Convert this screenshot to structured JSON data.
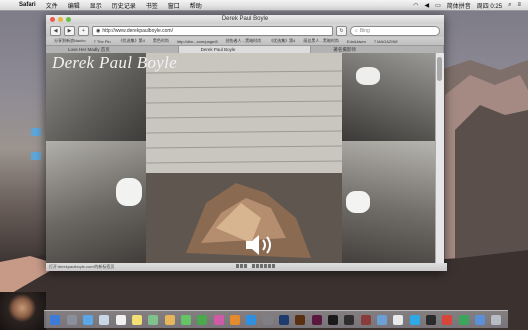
{
  "menubar": {
    "app_name": "Safari",
    "items": [
      "文件",
      "编辑",
      "显示",
      "历史记录",
      "书签",
      "窗口",
      "帮助"
    ],
    "clock": "周四 0:25",
    "locale": "简体拼音"
  },
  "desktop": {
    "icons": [
      {
        "label": "",
        "name": "desktop-icon-1"
      },
      {
        "label": "",
        "name": "desktop-icon-2"
      }
    ]
  },
  "window": {
    "title": "Derek Paul Boyle",
    "url": "http://www.derekpaulboyle.com/",
    "search_placeholder": "Bing",
    "bookmarks": [
      "分享到新浪Nacho",
      "7 The Pin",
      "《优选集》第4",
      "黑色时尚",
      "http://dim...com/page/8",
      "创伤者人 - 黑暗时尚",
      "《优选集》第4",
      "丽丝黑人 - 黑暗时尚",
      "Edn&kiwm",
      "7 MAGAZINE"
    ],
    "tabs": [
      {
        "label": "Love Her Madly 首页",
        "active": false
      },
      {
        "label": "Derek Paul Boyle",
        "active": true
      },
      {
        "label": "著名摄影师",
        "active": false
      }
    ],
    "page": {
      "site_title": "Derek Paul Boyle",
      "speaker_icon": "speaker-icon"
    },
    "status_text": "打开'derekpaulboyle.com'的新标签页"
  },
  "dock": {
    "apps": [
      "finder",
      "launchpad",
      "safari",
      "mail",
      "calendar",
      "notes",
      "maps",
      "photos",
      "messages",
      "facetime",
      "itunes",
      "ibooks",
      "app-store",
      "system-prefs",
      "photoshop",
      "illustrator",
      "indesign",
      "terminal",
      "activity-monitor",
      "dictionary",
      "preview",
      "textedit",
      "skype",
      "qq",
      "weibo",
      "qq-music",
      "folder",
      "trash"
    ]
  },
  "colors": {
    "accent_blue": "#3d6fcf",
    "close": "#ee5a52",
    "minimize": "#e9b43b",
    "zoom": "#6ac142"
  }
}
